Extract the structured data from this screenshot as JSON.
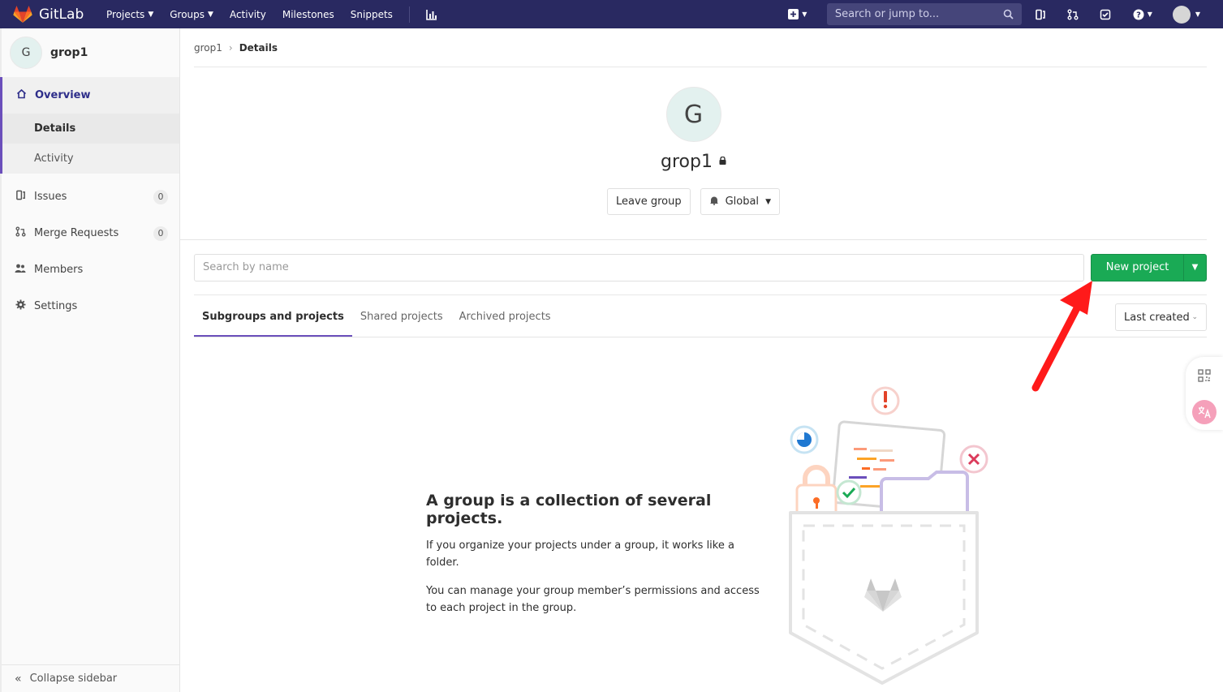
{
  "topnav": {
    "brand": "GitLab",
    "items": [
      {
        "label": "Projects",
        "caret": true
      },
      {
        "label": "Groups",
        "caret": true
      },
      {
        "label": "Activity",
        "caret": false
      },
      {
        "label": "Milestones",
        "caret": false
      },
      {
        "label": "Snippets",
        "caret": false
      }
    ],
    "search_placeholder": "Search or jump to...",
    "brand_color": "#292961"
  },
  "sidebar": {
    "group_initial": "G",
    "group_name": "grop1",
    "overview": "Overview",
    "sub_items": [
      "Details",
      "Activity"
    ],
    "issues": {
      "label": "Issues",
      "count": "0"
    },
    "merge_requests": {
      "label": "Merge Requests",
      "count": "0"
    },
    "members": "Members",
    "settings": "Settings",
    "collapse": "Collapse sidebar"
  },
  "breadcrumb": {
    "parent": "grop1",
    "current": "Details"
  },
  "group": {
    "initial": "G",
    "name": "grop1",
    "leave_button": "Leave group",
    "notification": "Global"
  },
  "toolbar": {
    "search_placeholder": "Search by name",
    "new_project": "New project",
    "accent": "#1aaa55"
  },
  "tabs": [
    {
      "label": "Subgroups and projects",
      "active": true
    },
    {
      "label": "Shared projects",
      "active": false
    },
    {
      "label": "Archived projects",
      "active": false
    }
  ],
  "sort": "Last created",
  "empty_state": {
    "title": "A group is a collection of several projects.",
    "line1": "If you organize your projects under a group, it works like a folder.",
    "line2": "You can manage your group member’s permissions and access to each project in the group."
  }
}
